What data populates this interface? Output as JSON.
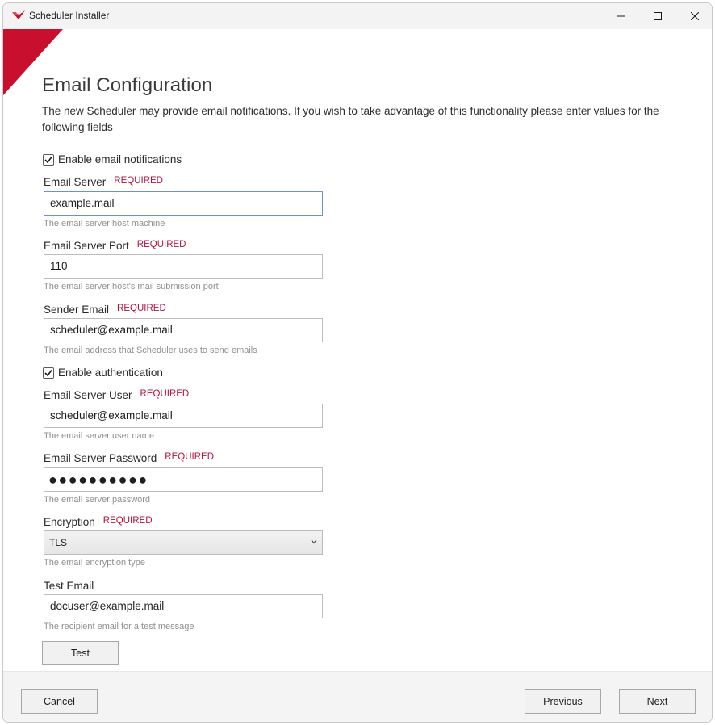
{
  "window": {
    "title": "Scheduler Installer",
    "accent_color": "#c8102e"
  },
  "page": {
    "heading": "Email Configuration",
    "intro": "The new Scheduler may provide email notifications.  If you wish to take advantage of this functionality please enter values for the following fields"
  },
  "form": {
    "required_label": "REQUIRED",
    "enable_notifications": {
      "label": "Enable email notifications",
      "checked": true
    },
    "email_server": {
      "label": "Email Server",
      "value": "example.mail",
      "help": "The email server host machine"
    },
    "email_server_port": {
      "label": "Email Server Port",
      "value": "110",
      "help": "The email server host's mail submission port"
    },
    "sender_email": {
      "label": "Sender Email",
      "value": "scheduler@example.mail",
      "help": "The email address that Scheduler uses to send emails"
    },
    "enable_authentication": {
      "label": "Enable authentication",
      "checked": true
    },
    "email_server_user": {
      "label": "Email Server User",
      "value": "scheduler@example.mail",
      "help": "The email server user name"
    },
    "email_server_password": {
      "label": "Email Server Password",
      "value": "●●●●●●●●●●",
      "help": "The email server password"
    },
    "encryption": {
      "label": "Encryption",
      "value": "TLS",
      "help": "The email encryption type"
    },
    "test_email": {
      "label": "Test Email",
      "value": "docuser@example.mail",
      "help": "The recipient email for a test message"
    },
    "test_button": "Test"
  },
  "footer": {
    "cancel": "Cancel",
    "previous": "Previous",
    "next": "Next"
  }
}
